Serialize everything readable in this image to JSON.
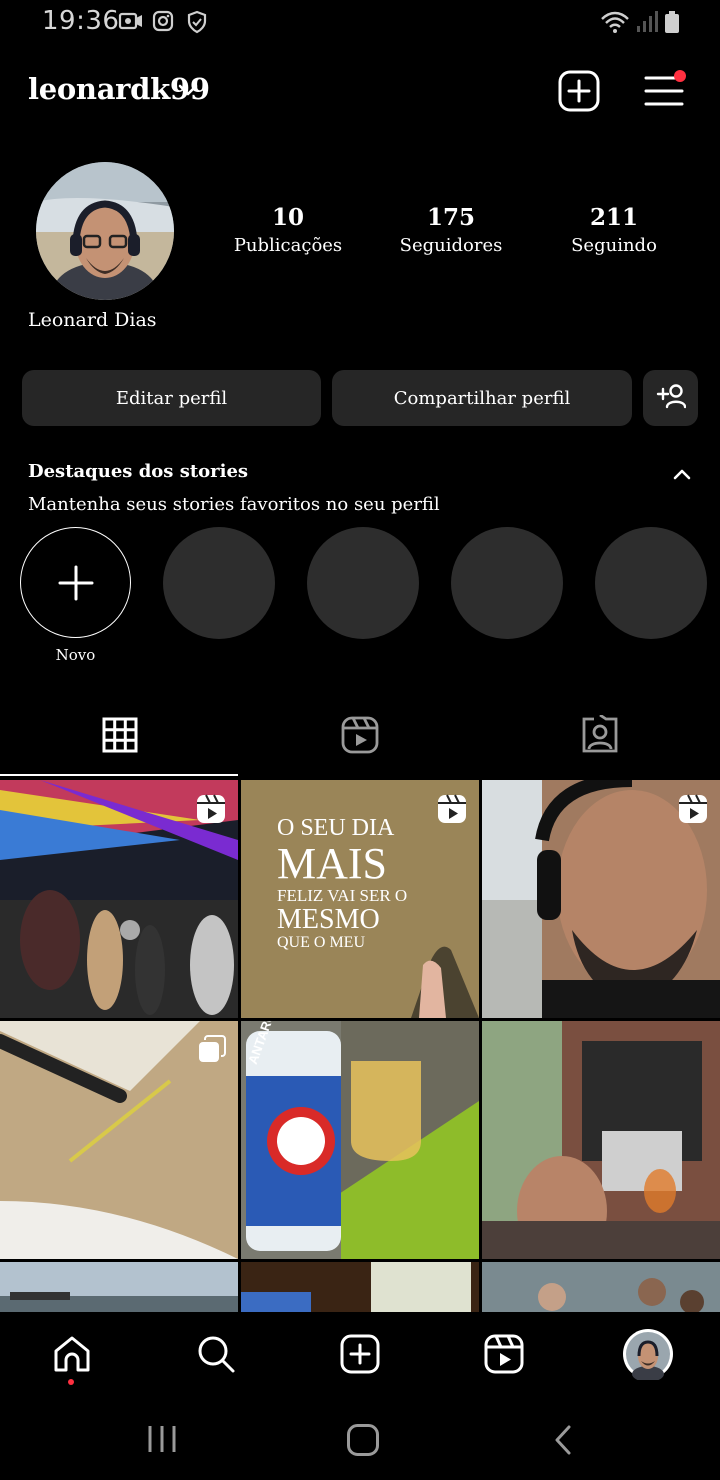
{
  "status_bar": {
    "time": "19:36",
    "icons": [
      "screenshot-icon",
      "instagram-icon",
      "shield-icon",
      "wifi-icon",
      "signal-icon",
      "battery-icon"
    ]
  },
  "header": {
    "username": "leonardk99",
    "icons": [
      "chevron-down-icon",
      "create-plus-icon",
      "menu-icon"
    ],
    "menu_badge_color": "#ff3040"
  },
  "profile": {
    "full_name": "Leonard Dias",
    "stats": [
      {
        "value": "10",
        "label": "Publicações"
      },
      {
        "value": "175",
        "label": "Seguidores"
      },
      {
        "value": "211",
        "label": "Seguindo"
      }
    ]
  },
  "actions": {
    "edit_label": "Editar perfil",
    "share_label": "Compartilhar perfil",
    "suggest_icon": "add-person-icon"
  },
  "highlights": {
    "title": "Destaques dos stories",
    "subtitle": "Mantenha seus stories favoritos no seu perfil",
    "new_label": "Novo"
  },
  "tabs": [
    "grid-icon",
    "reels-icon",
    "tagged-icon"
  ],
  "grid": {
    "tile_2_lines": [
      "O SEU DIA",
      "MAIS",
      "FELIZ VAI SER O",
      "MESMO",
      "QUE O MEU"
    ],
    "tile_5_brand": "ANTARCTICA"
  },
  "bottom_nav": [
    "home-icon",
    "search-icon",
    "create-icon",
    "reels-icon",
    "profile-avatar"
  ],
  "system_nav": [
    "recents-icon",
    "home-button-icon",
    "back-icon"
  ],
  "colors": {
    "background": "#000000",
    "button": "#262626",
    "accent": "#ff3040"
  }
}
